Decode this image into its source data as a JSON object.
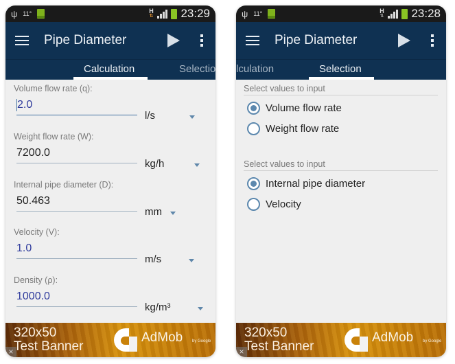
{
  "colors": {
    "action_bar": "#0f3152",
    "status_bar": "#1a1a1a",
    "accent": "#5c88ae",
    "value_blue": "#2e3a9c",
    "background": "#efefef"
  },
  "screens": [
    {
      "status_bar": {
        "usb_icon": "usb-icon",
        "temperature": "11°",
        "battery_small_label": "100%",
        "network": "H",
        "clock": "23:29"
      },
      "action_bar": {
        "title": "Pipe Diameter",
        "play_icon": "play-icon",
        "overflow_icon": "overflow-icon"
      },
      "tabs": [
        {
          "label": "Calculation",
          "active": true
        },
        {
          "label": "Selection",
          "active": false
        }
      ],
      "fields": [
        {
          "label": "Volume flow rate (q):",
          "value": "2.0",
          "unit": "l/s",
          "focused": true,
          "editable": true
        },
        {
          "label": "Weight flow rate (W):",
          "value": "7200.0",
          "unit": "kg/h",
          "focused": false,
          "editable": false
        },
        {
          "label": "Internal pipe diameter (D):",
          "value": "50.463",
          "unit": "mm",
          "focused": false,
          "editable": false
        },
        {
          "label": "Velocity (V):",
          "value": "1.0",
          "unit": "m/s",
          "focused": false,
          "editable": true
        },
        {
          "label": "Density (ρ):",
          "value": "1000.0",
          "unit": "kg/m³",
          "focused": false,
          "editable": true
        }
      ],
      "ad": {
        "size": "320x50",
        "label": "Test Banner",
        "brand": "AdMob",
        "by": "by Google",
        "close": "×"
      }
    },
    {
      "status_bar": {
        "usb_icon": "usb-icon",
        "temperature": "11°",
        "battery_small_label": "100%",
        "network": "H",
        "clock": "23:28"
      },
      "action_bar": {
        "title": "Pipe Diameter",
        "play_icon": "play-icon",
        "overflow_icon": "overflow-icon"
      },
      "tabs": [
        {
          "label": "lculation",
          "active": false
        },
        {
          "label": "Selection",
          "active": true
        }
      ],
      "groups": [
        {
          "label": "Select values to input",
          "options": [
            {
              "label": "Volume flow rate",
              "checked": true
            },
            {
              "label": "Weight flow rate",
              "checked": false
            }
          ]
        },
        {
          "label": "Select values to input",
          "options": [
            {
              "label": "Internal pipe diameter",
              "checked": true
            },
            {
              "label": "Velocity",
              "checked": false
            }
          ]
        }
      ],
      "ad": {
        "size": "320x50",
        "label": "Test Banner",
        "brand": "AdMob",
        "by": "by Google",
        "close": "×"
      }
    }
  ]
}
